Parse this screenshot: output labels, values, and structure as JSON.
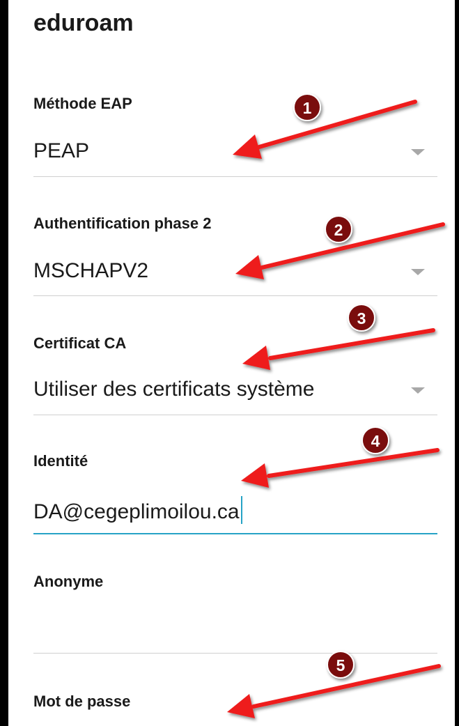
{
  "network": {
    "title": "eduroam"
  },
  "fields": {
    "eap_method": {
      "label": "Méthode EAP",
      "value": "PEAP"
    },
    "phase2": {
      "label": "Authentification phase 2",
      "value": "MSCHAPV2"
    },
    "ca_cert": {
      "label": "Certificat CA",
      "value": "Utiliser des certificats système"
    },
    "identity": {
      "label": "Identité",
      "value": "DA@cegeplimoilou.ca"
    },
    "anonymous": {
      "label": "Anonyme",
      "value": ""
    },
    "password": {
      "label": "Mot de passe"
    }
  },
  "annotations": {
    "badges": [
      "1",
      "2",
      "3",
      "4",
      "5"
    ],
    "badge_color": "#7a0f0f",
    "arrow_color": "#ee1c1c"
  },
  "colors": {
    "accent": "#26a3c6",
    "divider": "#cfcfcf",
    "text": "#1a1a1a",
    "spinner": "#a8a8a8"
  }
}
